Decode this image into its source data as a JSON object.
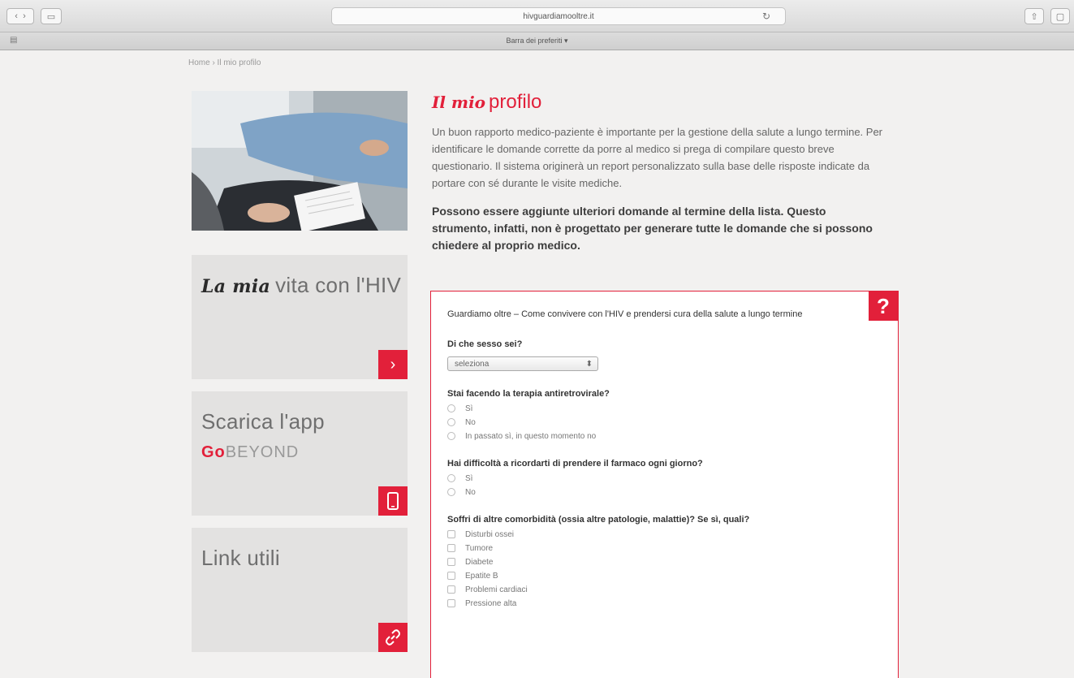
{
  "browser": {
    "url": "hivguardiamooltre.it",
    "bookmarks_label": "Barra dei preferiti ▾"
  },
  "breadcrumb": "Home › Il mio profilo",
  "page": {
    "title_script": "Il mio",
    "title_main": "profilo",
    "intro": "Un buon rapporto medico-paziente è importante per la gestione della salute a lungo termine. Per identificare le domande corrette da porre al medico si prega di compilare questo breve questionario. Il sistema originerà un report personalizzato sulla base delle risposte indicate da portare con sé durante le visite mediche.",
    "bold_intro": "Possono essere aggiunte ulteriori domande al termine della lista. Questo strumento, infatti, non è progettato per generare tutte le domande  che si possono chiedere al proprio medico."
  },
  "sidebar": {
    "card1": {
      "script": "La mia",
      "title": "vita con l'HIV"
    },
    "card2": {
      "title": "Scarica l'app",
      "brand_go": "Go",
      "brand_rest": "BEYOND"
    },
    "card3": {
      "title": "Link utili"
    }
  },
  "survey": {
    "help": "?",
    "title": "Guardiamo oltre – Come convivere con l'HIV e prendersi cura della salute a lungo termine",
    "q1": {
      "label": "Di che sesso sei?",
      "select_value": "seleziona"
    },
    "q2": {
      "label": "Stai facendo la terapia antiretrovirale?",
      "options": [
        "Sì",
        "No",
        "In passato sì, in questo momento no"
      ]
    },
    "q3": {
      "label": "Hai difficoltà a ricordarti di prendere il farmaco ogni giorno?",
      "options": [
        "Sì",
        "No"
      ]
    },
    "q4": {
      "label": "Soffri di altre comorbidità (ossia altre patologie, malattie)? Se sì, quali?",
      "options": [
        "Disturbi ossei",
        "Tumore",
        "Diabete",
        "Epatite B",
        "Problemi cardiaci",
        "Pressione alta"
      ]
    }
  },
  "colors": {
    "accent": "#e2203a",
    "card_bg": "#e3e2e1",
    "page_bg": "#f2f1f0"
  }
}
